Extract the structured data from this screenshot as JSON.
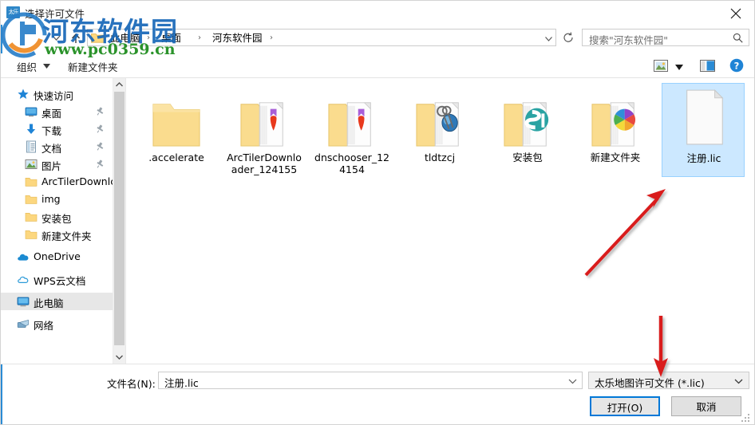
{
  "window": {
    "title": "选择许可文件",
    "app_icon": "太乐",
    "close_icon": "close-icon"
  },
  "navigation": {
    "recent_icon": "chevron-down-icon",
    "up_icon": "arrow-up-icon",
    "folder_icon": "folder-icon",
    "breadcrumbs": [
      "此电脑",
      "桌面",
      "河东软件园"
    ],
    "separator": "›",
    "address_dropdown_icon": "chevron-down-icon",
    "refresh_icon": "refresh-icon"
  },
  "search": {
    "placeholder": "搜索\"河东软件园\"",
    "icon": "search-icon"
  },
  "toolbar": {
    "organize_label": "组织",
    "organize_caret_icon": "caret-down-icon",
    "new_folder_label": "新建文件夹",
    "view_icon": "view-layout-icon",
    "view_caret_icon": "caret-down-icon",
    "preview_pane_icon": "preview-pane-icon",
    "help_icon": "help-icon"
  },
  "sidebar": {
    "items": [
      {
        "label": "快速访问",
        "icon": "star-icon",
        "indent": 20,
        "pinned": false,
        "selected": false
      },
      {
        "label": "桌面",
        "icon": "desktop-icon",
        "indent": 30,
        "pinned": true,
        "selected": false
      },
      {
        "label": "下载",
        "icon": "download-icon",
        "indent": 30,
        "pinned": true,
        "selected": false
      },
      {
        "label": "文档",
        "icon": "document-icon",
        "indent": 30,
        "pinned": true,
        "selected": false
      },
      {
        "label": "图片",
        "icon": "pictures-icon",
        "indent": 30,
        "pinned": true,
        "selected": false
      },
      {
        "label": "ArcTilerDownlc",
        "icon": "folder-icon",
        "indent": 30,
        "pinned": false,
        "selected": false
      },
      {
        "label": "img",
        "icon": "folder-icon",
        "indent": 30,
        "pinned": false,
        "selected": false
      },
      {
        "label": "安装包",
        "icon": "folder-icon",
        "indent": 30,
        "pinned": false,
        "selected": false
      },
      {
        "label": "新建文件夹",
        "icon": "folder-icon",
        "indent": 30,
        "pinned": false,
        "selected": false
      },
      {
        "label": "OneDrive",
        "icon": "onedrive-icon",
        "indent": 20,
        "pinned": false,
        "selected": false
      },
      {
        "label": "WPS云文档",
        "icon": "cloud-icon",
        "indent": 20,
        "pinned": false,
        "selected": false
      },
      {
        "label": "此电脑",
        "icon": "computer-icon",
        "indent": 20,
        "pinned": false,
        "selected": true
      },
      {
        "label": "网络",
        "icon": "network-icon",
        "indent": 20,
        "pinned": false,
        "selected": false
      }
    ],
    "scroll_up_icon": "chevron-up-icon",
    "scroll_down_icon": "chevron-down-icon"
  },
  "files": [
    {
      "name": ".accelerate",
      "type": "folder",
      "overlay": "none",
      "selected": false
    },
    {
      "name": "ArcTilerDownloader_124155",
      "type": "folder",
      "overlay": "pdf",
      "selected": false
    },
    {
      "name": "dnschooser_124154",
      "type": "folder",
      "overlay": "pdf",
      "selected": false
    },
    {
      "name": "tldtzcj",
      "type": "folder",
      "overlay": "keys",
      "selected": false
    },
    {
      "name": "安装包",
      "type": "folder",
      "overlay": "teal",
      "selected": false
    },
    {
      "name": "新建文件夹",
      "type": "folder",
      "overlay": "pinwheel",
      "selected": false
    },
    {
      "name": "注册.lic",
      "type": "file-generic",
      "overlay": "none",
      "selected": true
    }
  ],
  "footer": {
    "filename_label": "文件名(N):",
    "filename_value": "注册.lic",
    "filename_caret_icon": "chevron-down-icon",
    "filetype_value": "太乐地图许可文件 (*.lic)",
    "filetype_caret_icon": "chevron-down-icon",
    "open_button": "打开(O)",
    "cancel_button": "取消",
    "resize_grip_icon": "resize-grip-icon"
  },
  "watermark": {
    "text": "河东软件园",
    "url": "www.pc0359.cn",
    "logo_icon": "hedong-logo-icon"
  },
  "annotations": [
    {
      "name": "arrow-to-lic-file",
      "icon": "red-arrow-up-right-icon"
    },
    {
      "name": "arrow-to-filetype",
      "icon": "red-arrow-down-icon"
    }
  ],
  "colors": {
    "accent": "#0078d7",
    "selection": "#cce8ff",
    "annotation": "#d91b1b",
    "watermark_blue": "#1667b8",
    "watermark_green": "#1a8a1a"
  }
}
